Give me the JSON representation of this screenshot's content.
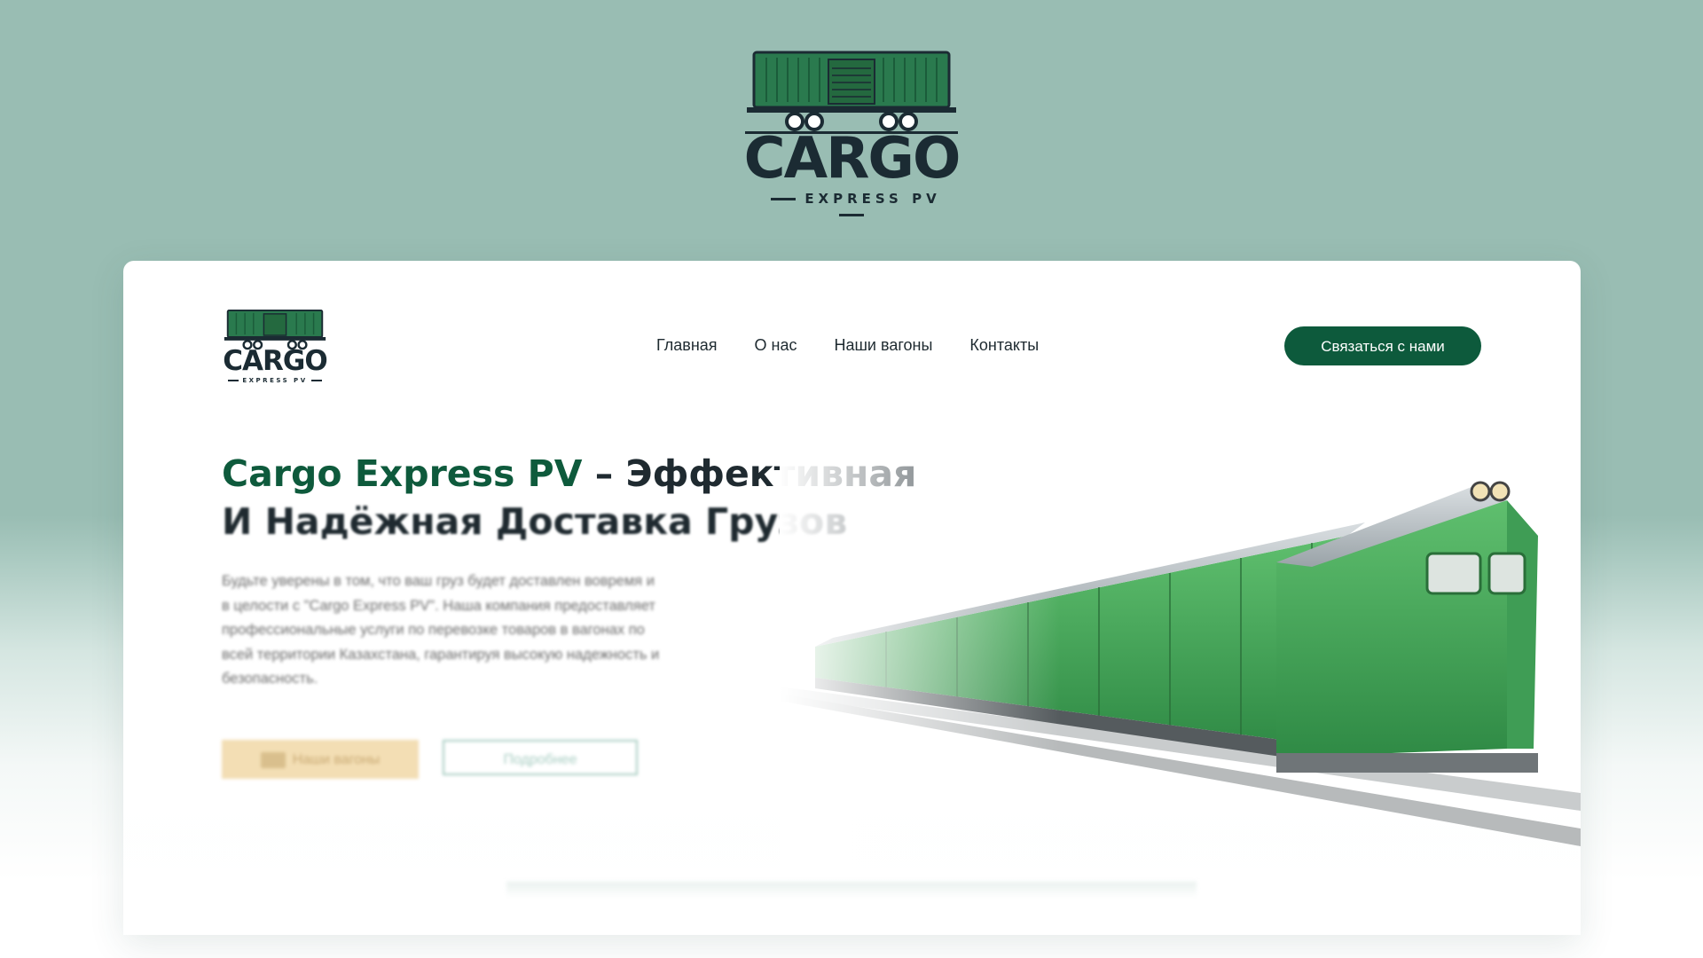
{
  "brand": {
    "wordmark": "CARGO",
    "subline": "EXPRESS PV",
    "colors": {
      "dark": "#1b2b33",
      "green": "#0d5a3c",
      "wagon": "#2a7a4e",
      "accent": "#f3deb4",
      "background": "#99bdb3"
    }
  },
  "nav": {
    "items": [
      "Главная",
      "О нас",
      "Наши вагоны",
      "Контакты"
    ],
    "cta": "Связаться с нами"
  },
  "hero": {
    "headline_brand": "Cargo Express PV",
    "headline_rest": " – Эффективная",
    "headline_line2": "И Надёжная Доставка Грузов",
    "description": "Будьте уверены в том, что ваш груз будет доставлен вовремя и в целости с \"Cargo Express PV\". Наша компания предоставляет профессиональные услуги по перевозке товаров в вагонах по всей территории Казахстана, гарантируя высокую надежность и безопасность.",
    "primary_button": "Наши вагоны",
    "primary_button_icon": "wagon-icon",
    "secondary_button": "Подробнее",
    "image": "freight-train"
  }
}
